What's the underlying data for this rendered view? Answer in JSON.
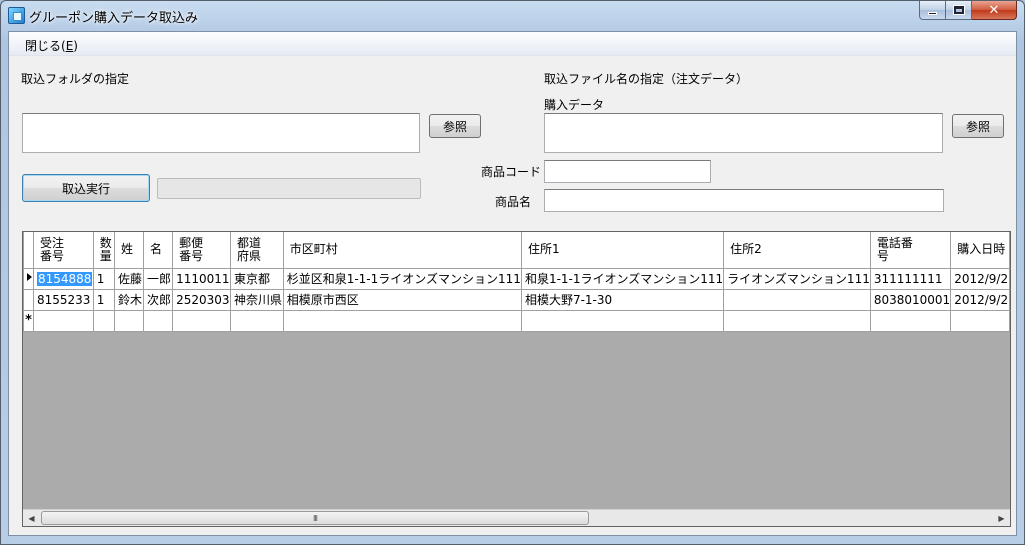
{
  "window": {
    "title": "グルーポン購入データ取込み",
    "minimize_glyph": "",
    "close_glyph": "✕"
  },
  "menu": {
    "close_label": "閉じる(",
    "close_accel": "E",
    "close_tail": ")"
  },
  "folder_section": {
    "label": "取込フォルダの指定",
    "path_value": "",
    "browse_label": "参照",
    "execute_label": "取込実行",
    "progress_value": 0
  },
  "file_section": {
    "label": "取込ファイル名の指定（注文データ）",
    "purchase_label": "購入データ",
    "purchase_value": "",
    "browse_label": "参照",
    "product_code_label": "商品コード",
    "product_code_value": "",
    "product_name_label": "商品名",
    "product_name_value": ""
  },
  "grid": {
    "columns": [
      {
        "line1": "受注",
        "line2": "番号"
      },
      {
        "line1": "数",
        "line2": "量"
      },
      {
        "line1": "姓",
        "line2": ""
      },
      {
        "line1": "名",
        "line2": ""
      },
      {
        "line1": "郵便",
        "line2": "番号"
      },
      {
        "line1": "都道",
        "line2": "府県"
      },
      {
        "line1": "市区町村",
        "line2": ""
      },
      {
        "line1": "住所1",
        "line2": ""
      },
      {
        "line1": "住所2",
        "line2": ""
      },
      {
        "line1": "電話番",
        "line2": "号"
      },
      {
        "line1": "購入日時",
        "line2": ""
      }
    ],
    "rows": [
      [
        "8154888",
        "1",
        "佐藤",
        "一郎",
        "1110011",
        "東京都",
        "杉並区和泉1-1-1ライオンズマンション111",
        "和泉1-1-1ライオンズマンション111",
        "ライオンズマンション111",
        "311111111",
        "2012/9/2"
      ],
      [
        "8155233",
        "1",
        "鈴木",
        "次郎",
        "2520303",
        "神奈川県",
        "相模原市西区",
        "相模大野7-1-30",
        "",
        "8038010001",
        "2012/9/2"
      ]
    ],
    "new_row_marker": "*",
    "scroll_thumb_grip": "III",
    "scroll_left": "◀",
    "scroll_right": "▶"
  }
}
